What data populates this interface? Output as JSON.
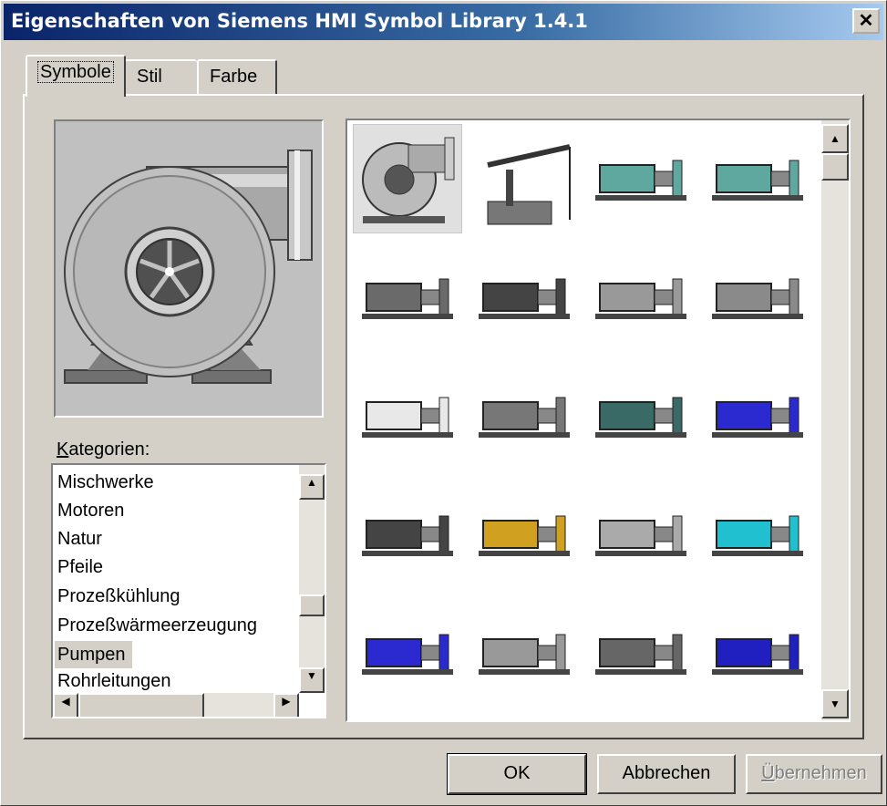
{
  "window": {
    "title": "Eigenschaften von Siemens HMI Symbol Library 1.4.1",
    "close_glyph": "✕"
  },
  "tabs": [
    {
      "label": "Symbole"
    },
    {
      "label": "Stil"
    },
    {
      "label": "Farbe"
    }
  ],
  "categories": {
    "label_accel": "K",
    "label_rest": "ategorien:",
    "items": [
      "Mischwerke",
      "Motoren",
      "Natur",
      "Pfeile",
      "Prozeßkühlung",
      "Prozeßwärmeerzeugung",
      "Pumpen",
      "Rohrleitungen"
    ],
    "selected": "Pumpen"
  },
  "symbols": {
    "selected_index": 0,
    "items": [
      "centrifugal-blower-icon",
      "oil-pumpjack-icon",
      "teal-motor-pump-icon",
      "teal-motor-pump-2-icon",
      "gray-motor-icon",
      "inline-pump-icon",
      "motor-pump-skid-icon",
      "close-coupled-pump-icon",
      "white-pump-icon",
      "vertical-pump-icon",
      "dark-pump-icon",
      "blue-motor-pump-icon",
      "long-shaft-pump-icon",
      "coupled-pump-icon",
      "large-gray-pump-icon",
      "cyan-pump-icon",
      "blue-motor-pump-2-icon",
      "gray-tank-pump-icon",
      "skid-pump-icon",
      "blue-gear-pump-icon"
    ]
  },
  "buttons": {
    "ok": "OK",
    "cancel": "Abbrechen",
    "apply_accel": "Ü",
    "apply_rest": "bernehmen"
  },
  "colors": {
    "title_start": "#0a246a",
    "title_end": "#a6caf0",
    "face": "#d4d0c8"
  }
}
